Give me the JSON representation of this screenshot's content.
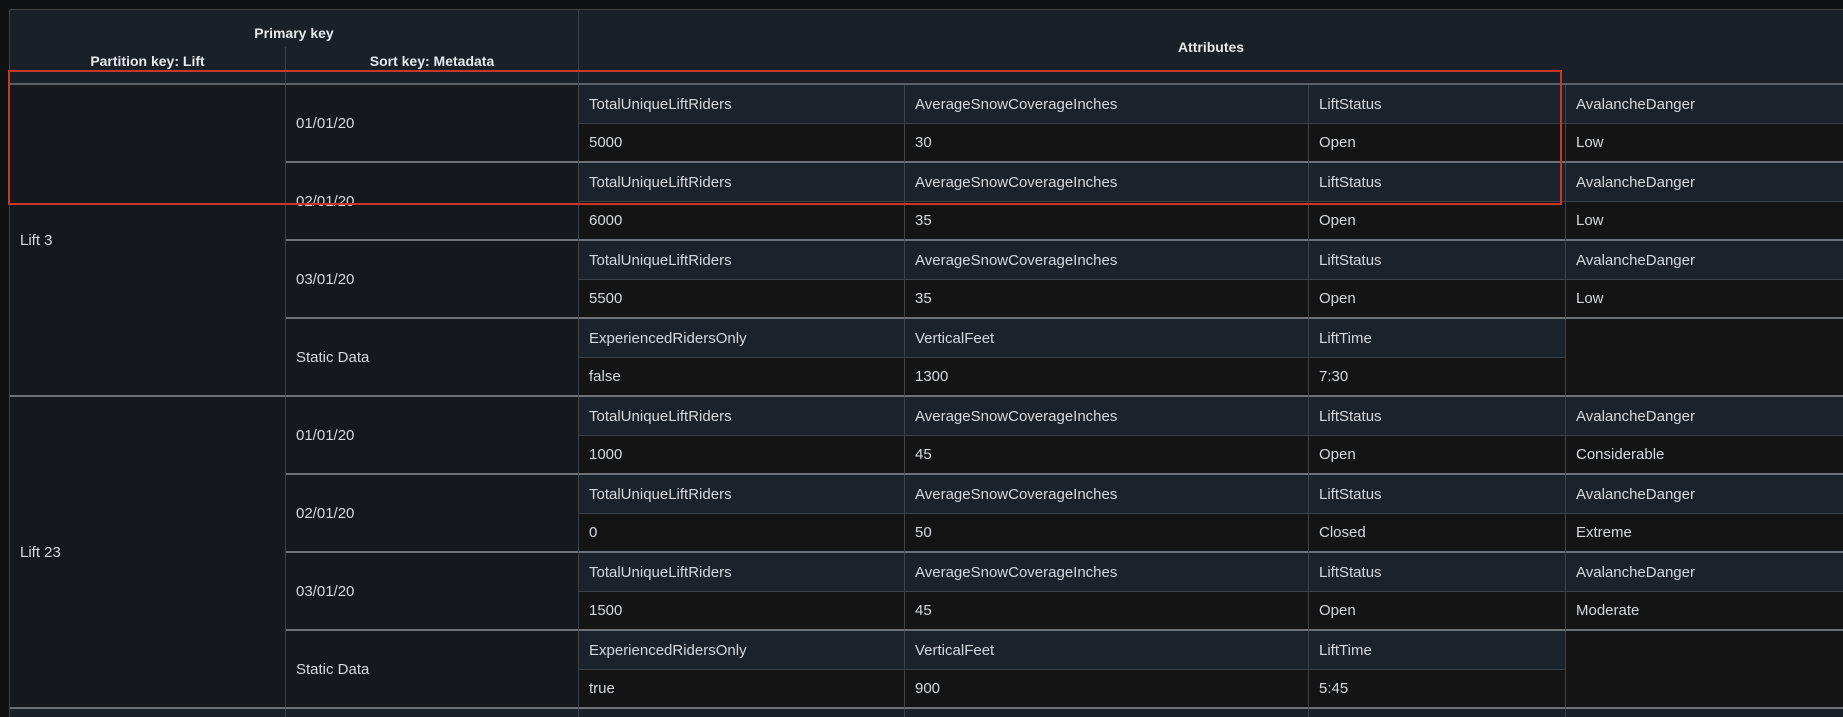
{
  "header": {
    "primary_key": "Primary key",
    "partition_key": "Partition key: Lift",
    "sort_key": "Sort key: Metadata",
    "attributes": "Attributes"
  },
  "items": [
    {
      "partition": "Lift 3",
      "rows": [
        {
          "sort": "01/01/20",
          "names": [
            "TotalUniqueLiftRiders",
            "AverageSnowCoverageInches",
            "LiftStatus",
            "AvalancheDanger"
          ],
          "values": [
            "5000",
            "30",
            "Open",
            "Low"
          ]
        },
        {
          "sort": "02/01/20",
          "names": [
            "TotalUniqueLiftRiders",
            "AverageSnowCoverageInches",
            "LiftStatus",
            "AvalancheDanger"
          ],
          "values": [
            "6000",
            "35",
            "Open",
            "Low"
          ]
        },
        {
          "sort": "03/01/20",
          "names": [
            "TotalUniqueLiftRiders",
            "AverageSnowCoverageInches",
            "LiftStatus",
            "AvalancheDanger"
          ],
          "values": [
            "5500",
            "35",
            "Open",
            "Low"
          ]
        },
        {
          "sort": "Static Data",
          "names": [
            "ExperiencedRidersOnly",
            "VerticalFeet",
            "LiftTime"
          ],
          "values": [
            "false",
            "1300",
            "7:30"
          ]
        }
      ]
    },
    {
      "partition": "Lift 23",
      "rows": [
        {
          "sort": "01/01/20",
          "names": [
            "TotalUniqueLiftRiders",
            "AverageSnowCoverageInches",
            "LiftStatus",
            "AvalancheDanger"
          ],
          "values": [
            "1000",
            "45",
            "Open",
            "Considerable"
          ]
        },
        {
          "sort": "02/01/20",
          "names": [
            "TotalUniqueLiftRiders",
            "AverageSnowCoverageInches",
            "LiftStatus",
            "AvalancheDanger"
          ],
          "values": [
            "0",
            "50",
            "Closed",
            "Extreme"
          ]
        },
        {
          "sort": "03/01/20",
          "names": [
            "TotalUniqueLiftRiders",
            "AverageSnowCoverageInches",
            "LiftStatus",
            "AvalancheDanger"
          ],
          "values": [
            "1500",
            "45",
            "Open",
            "Moderate"
          ]
        },
        {
          "sort": "Static Data",
          "names": [
            "ExperiencedRidersOnly",
            "VerticalFeet",
            "LiftTime"
          ],
          "values": [
            "true",
            "900",
            "5:45"
          ]
        }
      ]
    }
  ],
  "colors": {
    "background": "#0f1113",
    "header_bg": "#1a2027",
    "attr_name_bg": "#1a222b",
    "attr_value_bg": "#141414",
    "grid_line": "#3b4249",
    "highlight_border": "#c9362a"
  }
}
